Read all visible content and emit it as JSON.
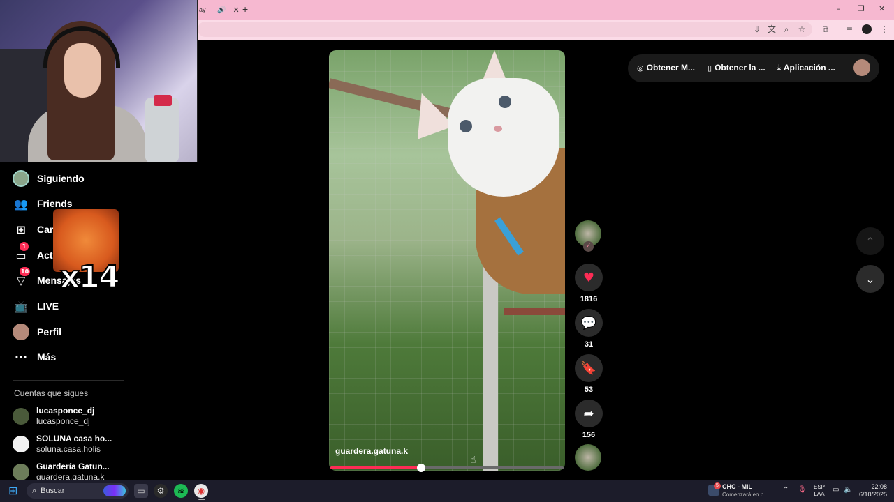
{
  "browser": {
    "tab_title": "ay",
    "tab_audio_icon": "speaker-icon",
    "tab_close": "✕",
    "new_tab": "+",
    "window_controls": [
      "–",
      "❐",
      "✕"
    ],
    "toolbar_icons": [
      "install-icon",
      "translate-icon",
      "zoom-icon",
      "star-icon",
      "extensions-icon",
      "media-icon",
      "profile-icon",
      "menu-icon"
    ]
  },
  "sidebar": {
    "items": [
      {
        "label": "Siguiendo",
        "icon": "avatar-icon"
      },
      {
        "label": "Friends",
        "icon": "friends-icon"
      },
      {
        "label": "Cargar",
        "icon": "upload-icon"
      },
      {
        "label": "Actividad",
        "icon": "activity-icon",
        "badge": "1"
      },
      {
        "label": "Mensajes",
        "icon": "messages-icon",
        "badge": "10"
      },
      {
        "label": "LIVE",
        "icon": "live-icon"
      },
      {
        "label": "Perfil",
        "icon": "profile-avatar-icon"
      },
      {
        "label": "Más",
        "icon": "more-icon"
      }
    ],
    "following_title": "Cuentas que sigues",
    "accounts": [
      {
        "name": "lucasponce_dj",
        "handle": "lucasponce_dj"
      },
      {
        "name": "SOLUNA casa ho...",
        "handle": "soluna.casa.holis"
      },
      {
        "name": "Guardería Gatun...",
        "handle": "guardera.gatuna.k"
      }
    ]
  },
  "overlay": {
    "meme_text": "x14"
  },
  "video": {
    "author": "guardera.gatuna.k",
    "progress": 0.39
  },
  "actions": {
    "likes": "1816",
    "comments": "31",
    "saves": "53",
    "shares": "156"
  },
  "topbar": {
    "items": [
      {
        "label": "Obtener M...",
        "icon": "coin-icon"
      },
      {
        "label": "Obtener la ...",
        "icon": "phone-icon"
      },
      {
        "label": "Aplicación ...",
        "icon": "download-icon"
      }
    ]
  },
  "taskbar": {
    "search_placeholder": "Buscar",
    "media_title": "CHC - MIL",
    "media_sub": "Comenzará en b...",
    "media_badge": "5",
    "lang_top": "ESP",
    "lang_bottom": "LAA",
    "time": "22:08",
    "date": "6/10/2025"
  },
  "colors": {
    "accent": "#fe2c55",
    "tab_bar": "#f6b8d0",
    "toolbar": "#fbdbe7"
  }
}
